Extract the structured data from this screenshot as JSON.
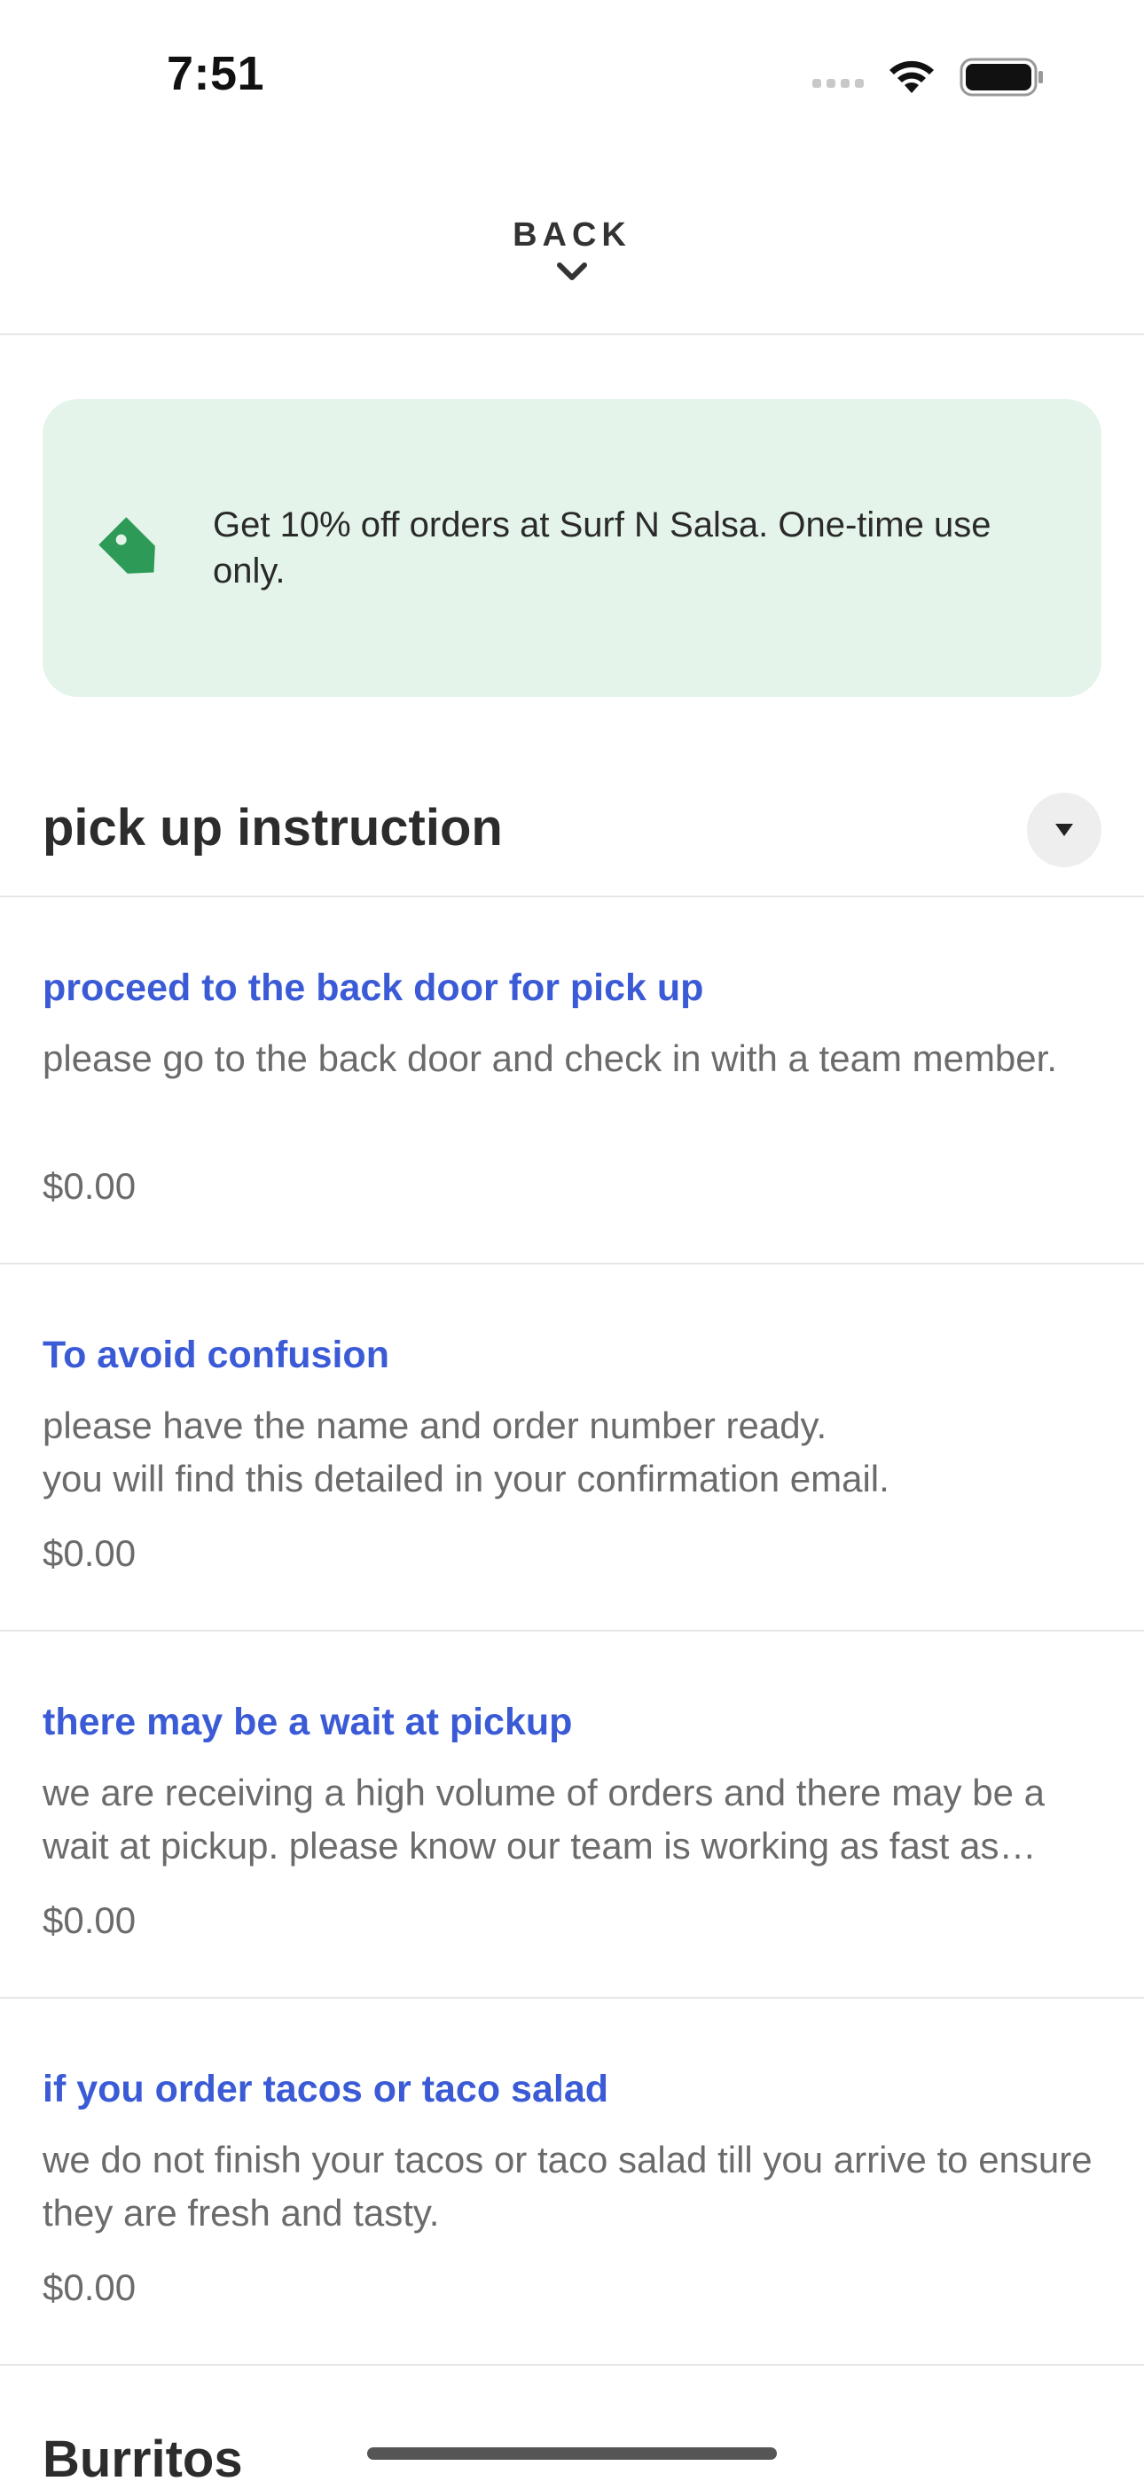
{
  "status_bar": {
    "time": "7:51"
  },
  "header": {
    "back_label": "BACK",
    "icon": "chevron-down-icon"
  },
  "promo": {
    "icon": "tag-icon",
    "text": "Get 10% off orders at Surf N Salsa. One-time use only.",
    "accent_color": "#2e9a57",
    "background_color": "#e5f4ea"
  },
  "section": {
    "title": "pick up instruction",
    "toggle_icon": "caret-down-icon"
  },
  "items": [
    {
      "title": "proceed to the back door for pick up",
      "description": "please go to the back door and check in with a team member.",
      "price": "$0.00"
    },
    {
      "title": "To avoid confusion",
      "description": "please have the name and order number ready.\nyou will find this detailed in your confirmation email.",
      "price": "$0.00"
    },
    {
      "title": "there may be a wait at pickup",
      "description": "we are receiving a high volume of orders and there may be a wait at pickup. please know our team is working as fast as…",
      "price": "$0.00"
    },
    {
      "title": "if you order tacos or taco salad",
      "description": "we do not finish your tacos or taco salad till you arrive to ensure they are fresh and tasty.",
      "price": "$0.00"
    }
  ],
  "next_section": {
    "title": "Burritos"
  },
  "colors": {
    "link_blue": "#3b5bd6",
    "muted_text": "#6b6b6b",
    "divider": "#e6e6e6"
  }
}
